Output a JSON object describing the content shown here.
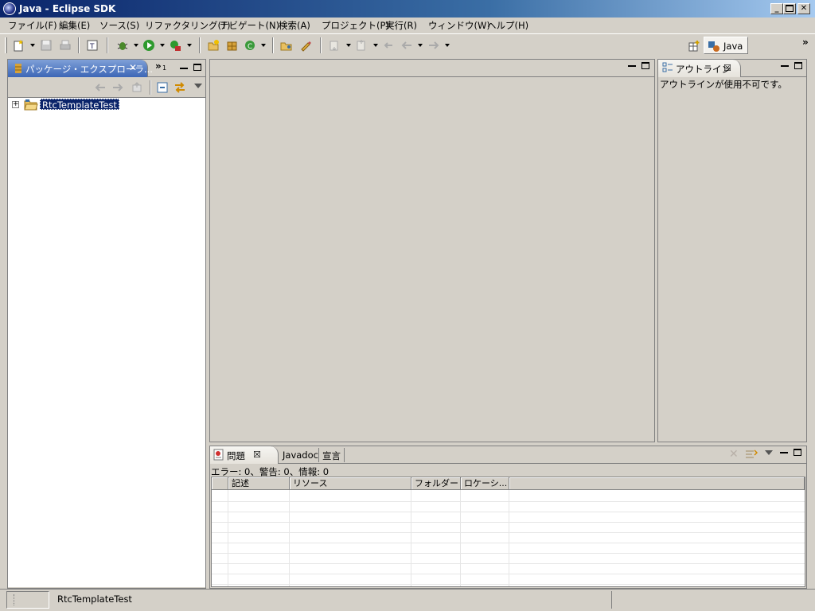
{
  "window": {
    "title": "Java - Eclipse SDK"
  },
  "menu": {
    "items": [
      {
        "label": "ファイル(F)"
      },
      {
        "label": "編集(E)"
      },
      {
        "label": "ソース(S)"
      },
      {
        "label": "リファクタリング(T)"
      },
      {
        "label": "ナビゲート(N)"
      },
      {
        "label": "検索(A)"
      },
      {
        "label": "プロジェクト(P)"
      },
      {
        "label": "実行(R)"
      },
      {
        "label": "ウィンドウ(W)"
      },
      {
        "label": "ヘルプ(H)"
      }
    ]
  },
  "perspective": {
    "active": "Java",
    "more": "»"
  },
  "package_explorer": {
    "tab_label": "パッケージ・エクスプローラ...",
    "overflow": "»",
    "overflow_count": "1",
    "tree": [
      {
        "label": "RtcTemplateTest",
        "expanded": false,
        "selected": true
      }
    ],
    "expander": "+"
  },
  "outline": {
    "tab_label": "アウトライン",
    "message": "アウトラインが使用不可です。"
  },
  "problems": {
    "tabs": [
      {
        "label": "問題"
      },
      {
        "label": "Javadoc"
      },
      {
        "label": "宣言"
      }
    ],
    "summary": "エラー: 0、警告: 0、情報: 0",
    "columns": [
      {
        "label": ""
      },
      {
        "label": "記述"
      },
      {
        "label": "リソース"
      },
      {
        "label": "フォルダー"
      },
      {
        "label": "ロケーシ..."
      }
    ],
    "rows": []
  },
  "statusbar": {
    "text": "RtcTemplateTest"
  },
  "colors": {
    "titlebar_start": "#0a246a",
    "titlebar_end": "#a6caf0",
    "active_tab_blue": "#3c66b6",
    "chrome": "#d4d0c8",
    "selection": "#0a246a"
  }
}
